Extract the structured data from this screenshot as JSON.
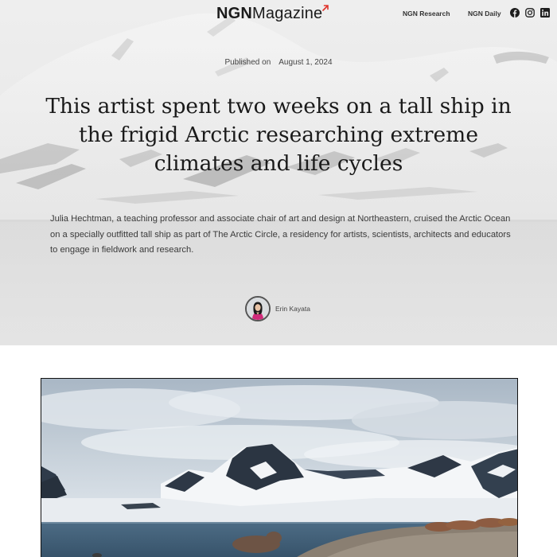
{
  "header": {
    "logo_bold": "NGN",
    "logo_regular": "Magazine",
    "nav": [
      "NGN Research",
      "NGN Daily"
    ],
    "social_icons": [
      "facebook-icon",
      "instagram-icon",
      "linkedin-icon"
    ],
    "accent_color": "#e0322a"
  },
  "article": {
    "published_label": "Published on",
    "published_date": "August 1, 2024",
    "headline": "This artist spent two weeks on a tall ship in the frigid Arctic researching extreme climates and life cycles",
    "dek": "Julia Hechtman, a teaching professor and associate chair of art and design at Northeastern, cruised the Arctic Ocean on a specially outfitted tall ship as part of The Arctic Circle, a residency for artists, scientists, architects and educators to engage in fieldwork and research.",
    "author": "Erin Kayata"
  }
}
